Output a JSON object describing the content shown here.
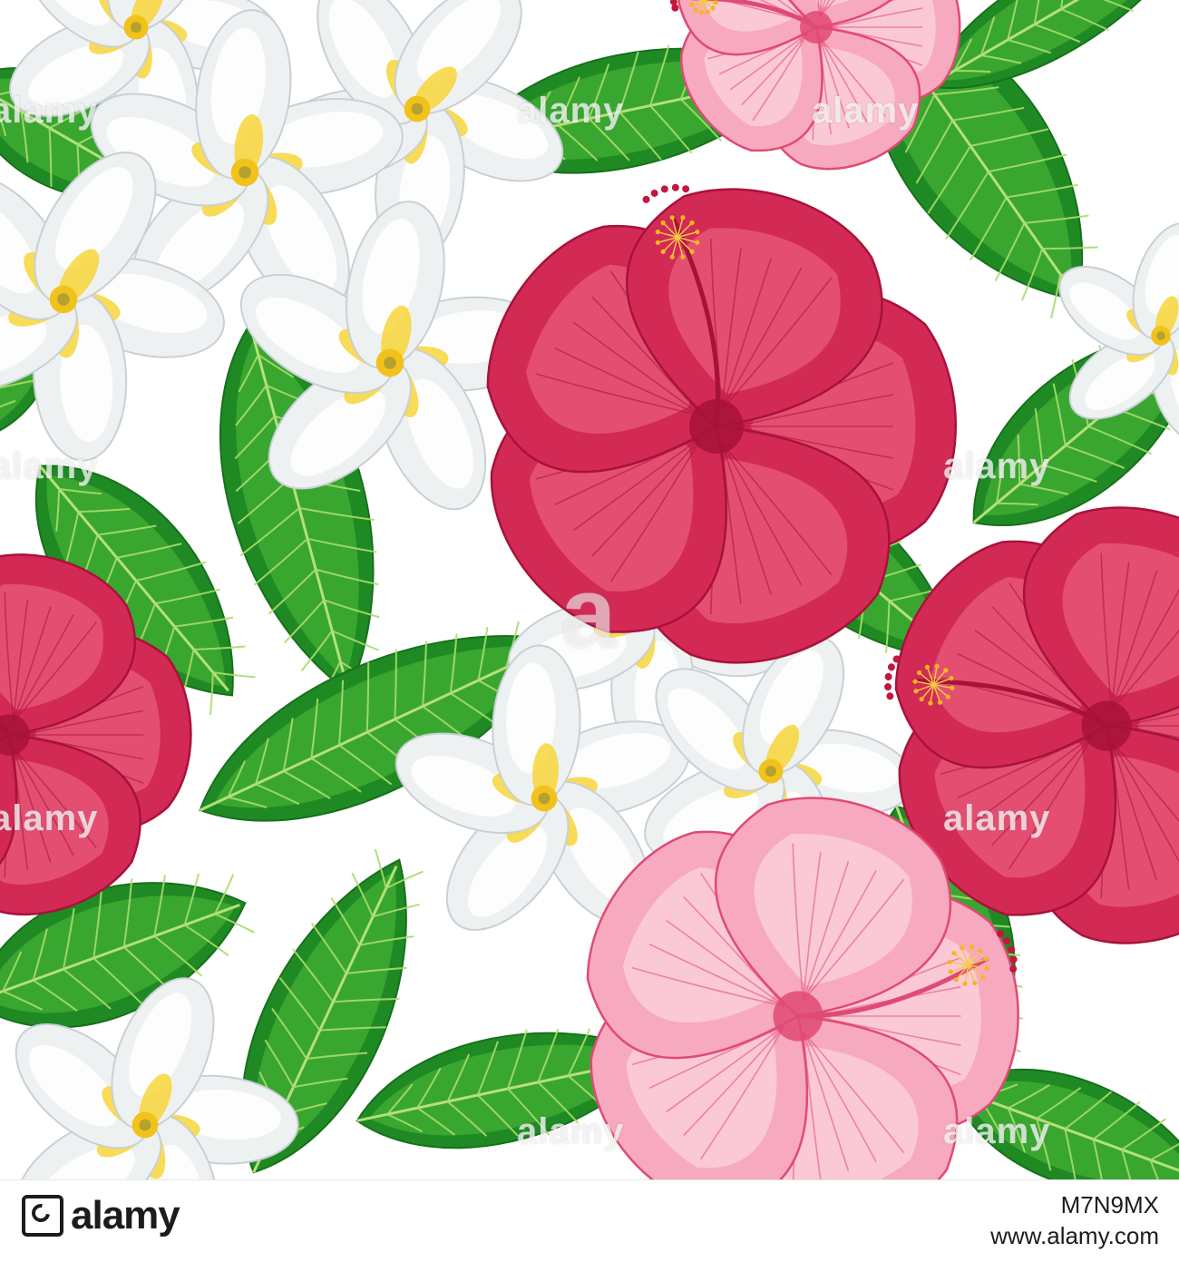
{
  "watermark": {
    "text": "alamy",
    "big_text": "a"
  },
  "footer": {
    "logo_text": "alamy",
    "image_id": "M7N9MX",
    "site": "www.alamy.com"
  },
  "colors": {
    "background": "#ffffff",
    "leaf_dark": "#1f8a24",
    "leaf_light": "#4fbe3a",
    "hibiscus_red": "#d22a55",
    "hibiscus_pink": "#f7a9bf",
    "plumeria_white": "#eef1f2",
    "plumeria_center": "#f7d53a"
  },
  "icons": {
    "logo": "alamy-logo-icon"
  }
}
